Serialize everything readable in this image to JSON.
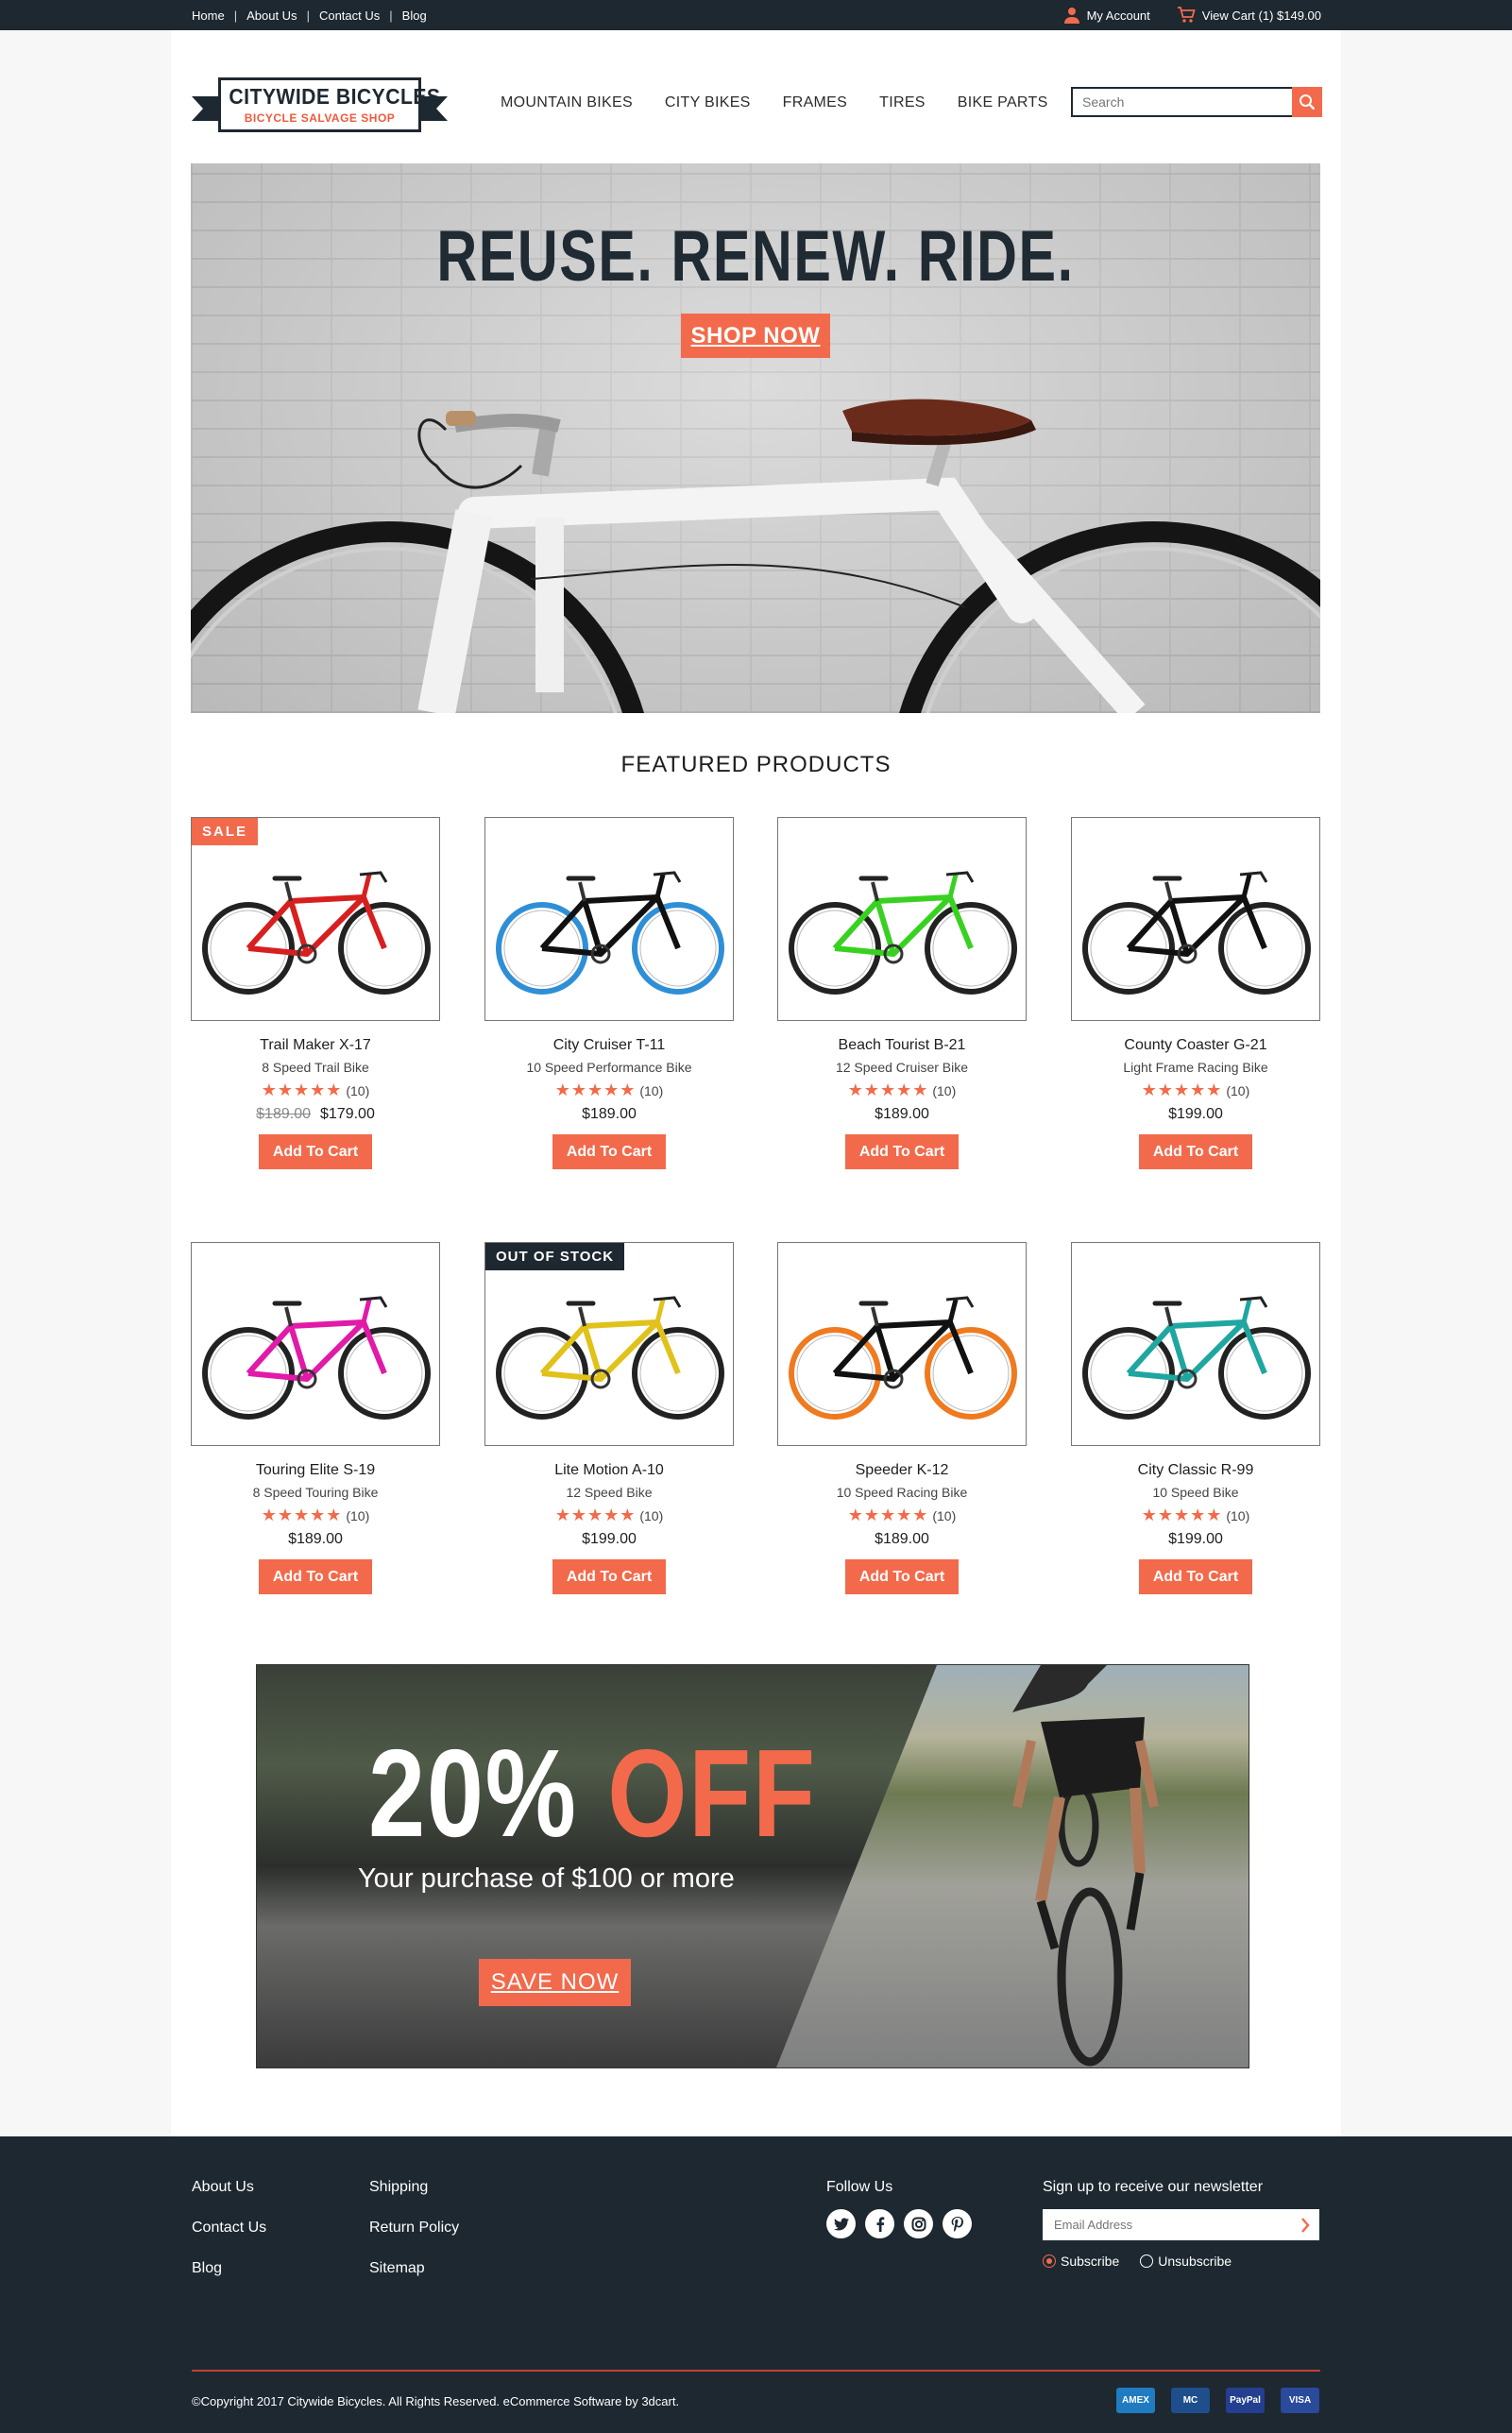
{
  "topbar": {
    "links": [
      "Home",
      "About Us",
      "Contact Us",
      "Blog"
    ],
    "account": "My Account",
    "cart": "View Cart (1) $149.00"
  },
  "logo": {
    "name": "CITYWIDE BICYCLES",
    "tagline": "BICYCLE SALVAGE SHOP"
  },
  "nav": [
    "MOUNTAIN BIKES",
    "CITY BIKES",
    "FRAMES",
    "TIRES",
    "BIKE PARTS"
  ],
  "search": {
    "placeholder": "Search"
  },
  "hero": {
    "headline": "REUSE. RENEW. RIDE.",
    "cta": "SHOP NOW"
  },
  "featured_title": "FEATURED PRODUCTS",
  "products": [
    {
      "name": "Trail Maker X-17",
      "subtitle": "8 Speed Trail Bike",
      "stars": "★★★★★",
      "reviews": "(10)",
      "old_price": "$189.00",
      "price": "$179.00",
      "badge": "SALE",
      "color": "#d81f1f",
      "rim": "#222222",
      "button": "Add To Cart"
    },
    {
      "name": "City Cruiser T-11",
      "subtitle": "10 Speed Performance Bike",
      "stars": "★★★★★",
      "reviews": "(10)",
      "old_price": "",
      "price": "$189.00",
      "badge": "",
      "color": "#111111",
      "rim": "#2f8fd6",
      "button": "Add To Cart"
    },
    {
      "name": "Beach Tourist B-21",
      "subtitle": "12 Speed Cruiser Bike",
      "stars": "★★★★★",
      "reviews": "(10)",
      "old_price": "",
      "price": "$189.00",
      "badge": "",
      "color": "#39d121",
      "rim": "#222222",
      "button": "Add To Cart"
    },
    {
      "name": "County Coaster G-21",
      "subtitle": "Light Frame Racing Bike",
      "stars": "★★★★★",
      "reviews": "(10)",
      "old_price": "",
      "price": "$199.00",
      "badge": "",
      "color": "#111111",
      "rim": "#222222",
      "button": "Add To Cart"
    },
    {
      "name": "Touring Elite S-19",
      "subtitle": "8 Speed Touring Bike",
      "stars": "★★★★★",
      "reviews": "(10)",
      "old_price": "",
      "price": "$189.00",
      "badge": "",
      "color": "#e11aa8",
      "rim": "#222222",
      "button": "Add To Cart"
    },
    {
      "name": "Lite Motion A-10",
      "subtitle": "12 Speed Bike",
      "stars": "★★★★★",
      "reviews": "(10)",
      "old_price": "",
      "price": "$199.00",
      "badge": "OUT OF STOCK",
      "color": "#e0c21a",
      "rim": "#222222",
      "button": "Add To Cart"
    },
    {
      "name": "Speeder K-12",
      "subtitle": "10 Speed Racing Bike",
      "stars": "★★★★★",
      "reviews": "(10)",
      "old_price": "",
      "price": "$189.00",
      "badge": "",
      "color": "#111111",
      "rim": "#ef7a1f",
      "button": "Add To Cart"
    },
    {
      "name": "City Classic R-99",
      "subtitle": "10 Speed Bike",
      "stars": "★★★★★",
      "reviews": "(10)",
      "old_price": "",
      "price": "$199.00",
      "badge": "",
      "color": "#1fa6a0",
      "rim": "#222222",
      "button": "Add To Cart"
    }
  ],
  "promo": {
    "percent": "20%",
    "off": "OFF",
    "subtitle": "Your purchase of $100 or more",
    "cta": "SAVE NOW"
  },
  "footer": {
    "col1": [
      "About Us",
      "Contact Us",
      "Blog"
    ],
    "col2": [
      "Shipping",
      "Return Policy",
      "Sitemap"
    ],
    "follow": "Follow Us",
    "social": [
      "twitter-icon",
      "facebook-icon",
      "instagram-icon",
      "pinterest-icon"
    ],
    "newsletter": "Sign up to receive our newsletter",
    "email_placeholder": "Email Address",
    "subscribe": "Subscribe",
    "unsubscribe": "Unsubscribe",
    "copyright": "©Copyright 2017 Citywide Bicycles. All Rights Reserved. eCommerce Software by 3dcart.",
    "payments": [
      {
        "label": "AMEX",
        "color": "#1f7cc0"
      },
      {
        "label": "MC",
        "color": "#1f4e8c"
      },
      {
        "label": "PayPal",
        "color": "#243f8f"
      },
      {
        "label": "VISA",
        "color": "#2a4a9c"
      }
    ]
  },
  "colors": {
    "accent": "#f26a4b",
    "dark": "#1d2831"
  }
}
